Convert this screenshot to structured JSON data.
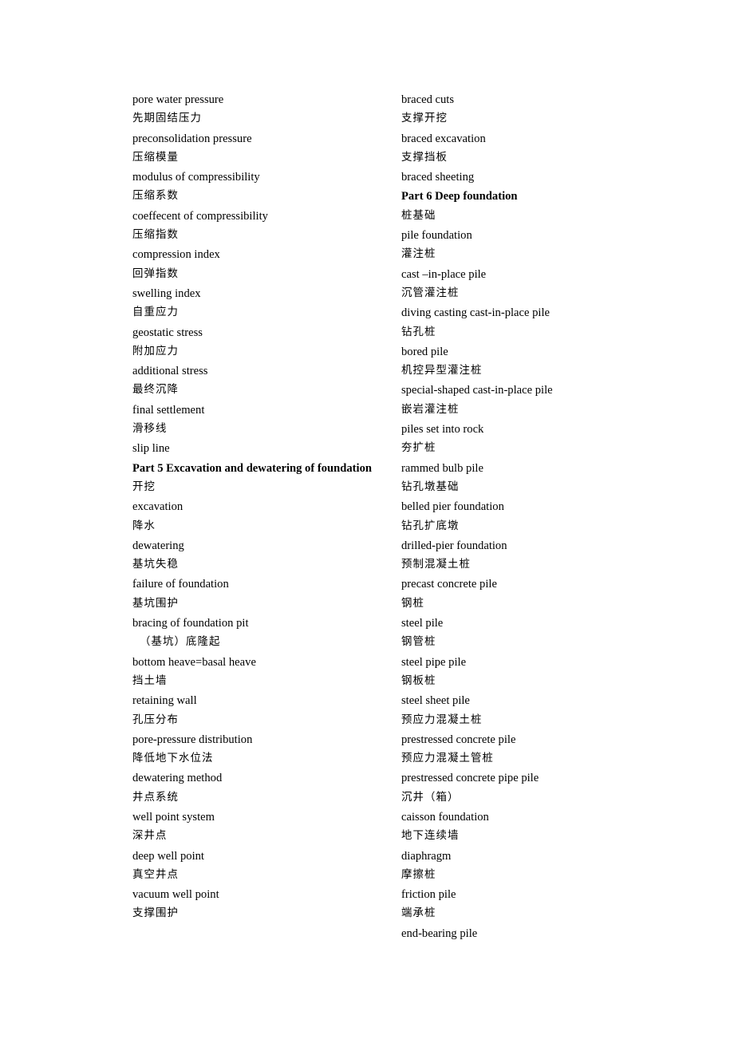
{
  "document": {
    "type": "bilingual-glossary",
    "background_color": "#ffffff",
    "text_color": "#000000",
    "columns": 2
  },
  "left_column": {
    "lines": [
      {
        "text": "pore water pressure",
        "lang": "en",
        "style": "normal"
      },
      {
        "text": "先期固结压力",
        "lang": "zh",
        "style": "normal"
      },
      {
        "text": "preconsolidation pressure",
        "lang": "en",
        "style": "normal"
      },
      {
        "text": "压缩模量",
        "lang": "zh",
        "style": "normal"
      },
      {
        "text": "modulus of compressibility",
        "lang": "en",
        "style": "normal"
      },
      {
        "text": "压缩系数",
        "lang": "zh",
        "style": "normal"
      },
      {
        "text": "coeffecent of compressibility",
        "lang": "en",
        "style": "normal"
      },
      {
        "text": "压缩指数",
        "lang": "zh",
        "style": "normal"
      },
      {
        "text": "compression index",
        "lang": "en",
        "style": "normal"
      },
      {
        "text": "回弹指数",
        "lang": "zh",
        "style": "normal"
      },
      {
        "text": "swelling index",
        "lang": "en",
        "style": "normal"
      },
      {
        "text": "自重应力",
        "lang": "zh",
        "style": "normal"
      },
      {
        "text": "geostatic stress",
        "lang": "en",
        "style": "normal"
      },
      {
        "text": "附加应力",
        "lang": "zh",
        "style": "normal"
      },
      {
        "text": "additional stress",
        "lang": "en",
        "style": "normal"
      },
      {
        "text": "最终沉降",
        "lang": "zh",
        "style": "normal"
      },
      {
        "text": "final settlement",
        "lang": "en",
        "style": "normal"
      },
      {
        "text": "滑移线",
        "lang": "zh",
        "style": "normal"
      },
      {
        "text": "slip line",
        "lang": "en",
        "style": "normal"
      },
      {
        "text": "Part 5 Excavation and dewatering of foundation",
        "lang": "en",
        "style": "heading-justified"
      },
      {
        "text": "开挖",
        "lang": "zh",
        "style": "normal"
      },
      {
        "text": "excavation",
        "lang": "en",
        "style": "normal"
      },
      {
        "text": "降水",
        "lang": "zh",
        "style": "normal"
      },
      {
        "text": "dewatering",
        "lang": "en",
        "style": "normal"
      },
      {
        "text": "基坑失稳",
        "lang": "zh",
        "style": "normal"
      },
      {
        "text": "failure of foundation",
        "lang": "en",
        "style": "normal"
      },
      {
        "text": "基坑围护",
        "lang": "zh",
        "style": "normal"
      },
      {
        "text": "bracing of foundation pit",
        "lang": "en",
        "style": "normal"
      },
      {
        "text": "（基坑）底隆起",
        "lang": "zh",
        "style": "indent"
      },
      {
        "text": "bottom heave=basal heave",
        "lang": "en",
        "style": "normal"
      },
      {
        "text": "挡土墙",
        "lang": "zh",
        "style": "normal"
      },
      {
        "text": "retaining wall",
        "lang": "en",
        "style": "normal"
      },
      {
        "text": "孔压分布",
        "lang": "zh",
        "style": "normal"
      },
      {
        "text": "pore-pressure distribution",
        "lang": "en",
        "style": "normal"
      },
      {
        "text": "降低地下水位法",
        "lang": "zh",
        "style": "normal"
      },
      {
        "text": "dewatering method",
        "lang": "en",
        "style": "normal"
      },
      {
        "text": "井点系统",
        "lang": "zh",
        "style": "normal"
      },
      {
        "text": "well point system",
        "lang": "en",
        "style": "normal"
      },
      {
        "text": "深井点",
        "lang": "zh",
        "style": "normal"
      },
      {
        "text": "deep well point",
        "lang": "en",
        "style": "normal"
      },
      {
        "text": "真空井点",
        "lang": "zh",
        "style": "normal"
      },
      {
        "text": "vacuum well point",
        "lang": "en",
        "style": "normal"
      },
      {
        "text": "支撑围护",
        "lang": "zh",
        "style": "normal"
      }
    ]
  },
  "right_column": {
    "lines": [
      {
        "text": "braced cuts",
        "lang": "en",
        "style": "normal"
      },
      {
        "text": "支撑开挖",
        "lang": "zh",
        "style": "normal"
      },
      {
        "text": "braced excavation",
        "lang": "en",
        "style": "normal"
      },
      {
        "text": "支撑挡板",
        "lang": "zh",
        "style": "normal"
      },
      {
        "text": "braced sheeting",
        "lang": "en",
        "style": "normal"
      },
      {
        "text": "Part 6 Deep foundation",
        "lang": "en",
        "style": "heading"
      },
      {
        "text": "桩基础",
        "lang": "zh",
        "style": "normal"
      },
      {
        "text": "pile foundation",
        "lang": "en",
        "style": "normal"
      },
      {
        "text": "灌注桩",
        "lang": "zh",
        "style": "normal"
      },
      {
        "text": "cast –in-place pile",
        "lang": "en",
        "style": "normal"
      },
      {
        "text": "沉管灌注桩",
        "lang": "zh",
        "style": "normal"
      },
      {
        "text": "diving casting cast-in-place pile",
        "lang": "en",
        "style": "normal"
      },
      {
        "text": "钻孔桩",
        "lang": "zh",
        "style": "normal"
      },
      {
        "text": "bored pile",
        "lang": "en",
        "style": "normal"
      },
      {
        "text": "机控异型灌注桩",
        "lang": "zh",
        "style": "normal"
      },
      {
        "text": "special-shaped cast-in-place pile",
        "lang": "en",
        "style": "normal"
      },
      {
        "text": "嵌岩灌注桩",
        "lang": "zh",
        "style": "normal"
      },
      {
        "text": "piles set into rock",
        "lang": "en",
        "style": "normal"
      },
      {
        "text": "夯扩桩",
        "lang": "zh",
        "style": "normal"
      },
      {
        "text": "rammed bulb pile",
        "lang": "en",
        "style": "normal"
      },
      {
        "text": "钻孔墩基础",
        "lang": "zh",
        "style": "normal"
      },
      {
        "text": "belled pier foundation",
        "lang": "en",
        "style": "normal"
      },
      {
        "text": "钻孔扩底墩",
        "lang": "zh",
        "style": "normal"
      },
      {
        "text": "drilled-pier foundation",
        "lang": "en",
        "style": "normal"
      },
      {
        "text": "预制混凝土桩",
        "lang": "zh",
        "style": "normal"
      },
      {
        "text": "precast concrete pile",
        "lang": "en",
        "style": "normal"
      },
      {
        "text": "钢桩",
        "lang": "zh",
        "style": "normal"
      },
      {
        "text": "steel pile",
        "lang": "en",
        "style": "normal"
      },
      {
        "text": "钢管桩",
        "lang": "zh",
        "style": "normal"
      },
      {
        "text": "steel pipe pile",
        "lang": "en",
        "style": "normal"
      },
      {
        "text": "钢板桩",
        "lang": "zh",
        "style": "normal"
      },
      {
        "text": "steel sheet pile",
        "lang": "en",
        "style": "normal"
      },
      {
        "text": "预应力混凝土桩",
        "lang": "zh",
        "style": "normal"
      },
      {
        "text": "prestressed concrete pile",
        "lang": "en",
        "style": "normal"
      },
      {
        "text": "预应力混凝土管桩",
        "lang": "zh",
        "style": "normal"
      },
      {
        "text": "prestressed concrete pipe pile",
        "lang": "en",
        "style": "normal"
      },
      {
        "text": "沉井（箱）",
        "lang": "zh",
        "style": "normal"
      },
      {
        "text": "caisson foundation",
        "lang": "en",
        "style": "normal"
      },
      {
        "text": "地下连续墙",
        "lang": "zh",
        "style": "normal"
      },
      {
        "text": "diaphragm",
        "lang": "en",
        "style": "normal"
      },
      {
        "text": "摩擦桩",
        "lang": "zh",
        "style": "normal"
      },
      {
        "text": "friction pile",
        "lang": "en",
        "style": "normal"
      },
      {
        "text": "端承桩",
        "lang": "zh",
        "style": "normal"
      },
      {
        "text": "end-bearing pile",
        "lang": "en",
        "style": "normal"
      }
    ]
  }
}
